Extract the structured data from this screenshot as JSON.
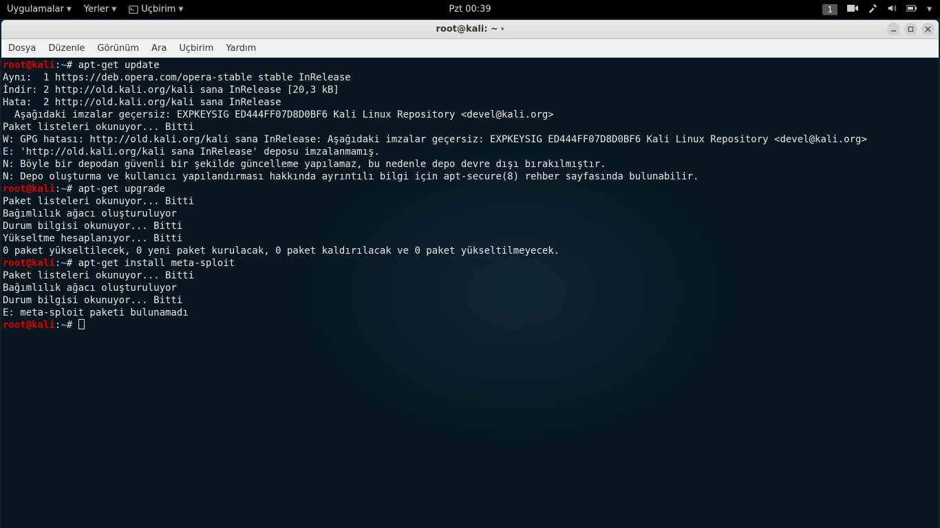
{
  "panel": {
    "apps": "Uygulamalar",
    "places": "Yerler",
    "terminal": "Uçbirim",
    "clock": "Pzt 00:39",
    "workspace": "1"
  },
  "window": {
    "title": "root@kali: ~"
  },
  "menubar": {
    "file": "Dosya",
    "edit": "Düzenle",
    "view": "Görünüm",
    "search": "Ara",
    "terminal": "Uçbirim",
    "help": "Yardım"
  },
  "prompt": {
    "user": "root",
    "at": "@",
    "host": "kali",
    "colon": ":",
    "path": "~",
    "hash": "#"
  },
  "term": {
    "cmd1": " apt-get update",
    "l1": "Aynı:  1 https://deb.opera.com/opera-stable stable InRelease",
    "l2": "İndir: 2 http://old.kali.org/kali sana InRelease [20,3 kB]",
    "l3": "Hata:  2 http://old.kali.org/kali sana InRelease",
    "l4": "  Aşağıdaki imzalar geçersiz: EXPKEYSIG ED444FF07D8D0BF6 Kali Linux Repository <devel@kali.org>",
    "l5": "Paket listeleri okunuyor... Bitti",
    "l6": "W: GPG hatası: http://old.kali.org/kali sana InRelease: Aşağıdaki imzalar geçersiz: EXPKEYSIG ED444FF07D8D0BF6 Kali Linux Repository <devel@kali.org>",
    "l7": "E: 'http://old.kali.org/kali sana InRelease' deposu imzalanmamış.",
    "l8": "N: Böyle bir depodan güvenli bir şekilde güncelleme yapılamaz, bu nedenle depo devre dışı bırakılmıştır.",
    "l9": "N: Depo oluşturma ve kullanıcı yapılandırması hakkında ayrıntılı bilgi için apt-secure(8) rehber sayfasında bulunabilir.",
    "cmd2": " apt-get upgrade",
    "l10": "Paket listeleri okunuyor... Bitti",
    "l11": "Bağımlılık ağacı oluşturuluyor",
    "l12": "Durum bilgisi okunuyor... Bitti",
    "l13": "Yükseltme hesaplanıyor... Bitti",
    "l14": "0 paket yükseltilecek, 0 yeni paket kurulacak, 0 paket kaldırılacak ve 0 paket yükseltilmeyecek.",
    "cmd3": " apt-get install meta-sploit",
    "l15": "Paket listeleri okunuyor... Bitti",
    "l16": "Bağımlılık ağacı oluşturuluyor",
    "l17": "Durum bilgisi okunuyor... Bitti",
    "l18": "E: meta-sploit paketi bulunamadı"
  }
}
